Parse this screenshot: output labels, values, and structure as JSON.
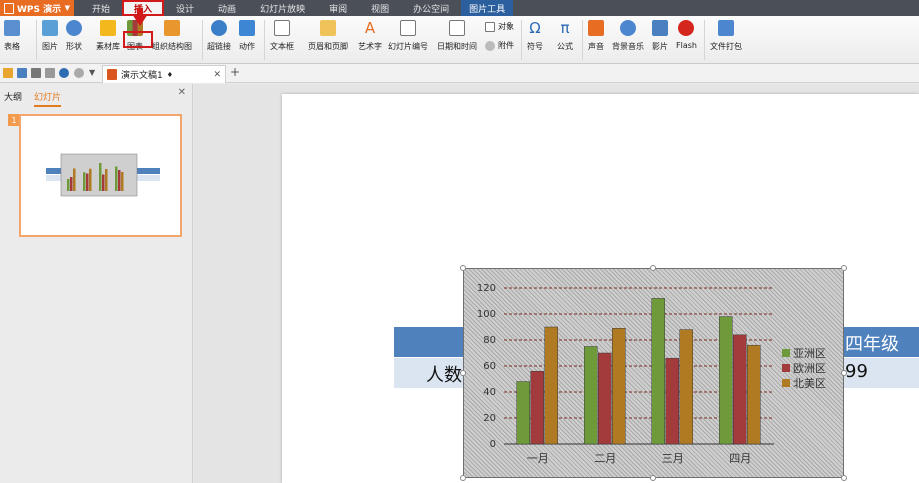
{
  "app": {
    "name": "WPS 演示"
  },
  "menu": [
    "开始",
    "插入",
    "设计",
    "动画",
    "幻灯片放映",
    "审阅",
    "视图",
    "办公空间"
  ],
  "menu_active": "插入",
  "context_tab": "图片工具",
  "ribbon": {
    "table": "表格",
    "picture": "图片",
    "shape": "形状",
    "material": "素材库",
    "chart": "图表",
    "org_chart": "组织结构图",
    "hyperlink": "超链接",
    "action": "动作",
    "textbox": "文本框",
    "header_footer": "页眉和页脚",
    "wordart": "艺术字",
    "slide_number": "幻灯片编号",
    "datetime": "日期和时间",
    "object": "对象",
    "attachment": "附件",
    "symbol": "符号",
    "formula": "公式",
    "sound": "声音",
    "bg_music": "背景音乐",
    "movie": "影片",
    "flash": "Flash",
    "package": "文件打包"
  },
  "document": {
    "tab_title": "演示文稿1"
  },
  "panel": {
    "tab_outline": "大纲",
    "tab_slides": "幻灯片",
    "slide_number": "1"
  },
  "slide_table": {
    "row1_right": "四年级",
    "row2_left": "人数",
    "row2_right": "99"
  },
  "colors": {
    "series1": "#6f9a3a",
    "series2": "#a33a3c",
    "series3": "#b07a22",
    "table_header": "#4f81bd",
    "table_row": "#dbe5f1"
  },
  "chart_data": {
    "type": "bar",
    "categories": [
      "一月",
      "二月",
      "三月",
      "四月"
    ],
    "series": [
      {
        "name": "亚洲区",
        "values": [
          48,
          75,
          112,
          98
        ]
      },
      {
        "name": "欧洲区",
        "values": [
          56,
          70,
          66,
          84
        ]
      },
      {
        "name": "北美区",
        "values": [
          90,
          89,
          88,
          76
        ]
      }
    ],
    "ylim": [
      0,
      120
    ],
    "yticks": [
      0,
      20,
      40,
      60,
      80,
      100,
      120
    ],
    "grid": true,
    "legend": "right"
  }
}
